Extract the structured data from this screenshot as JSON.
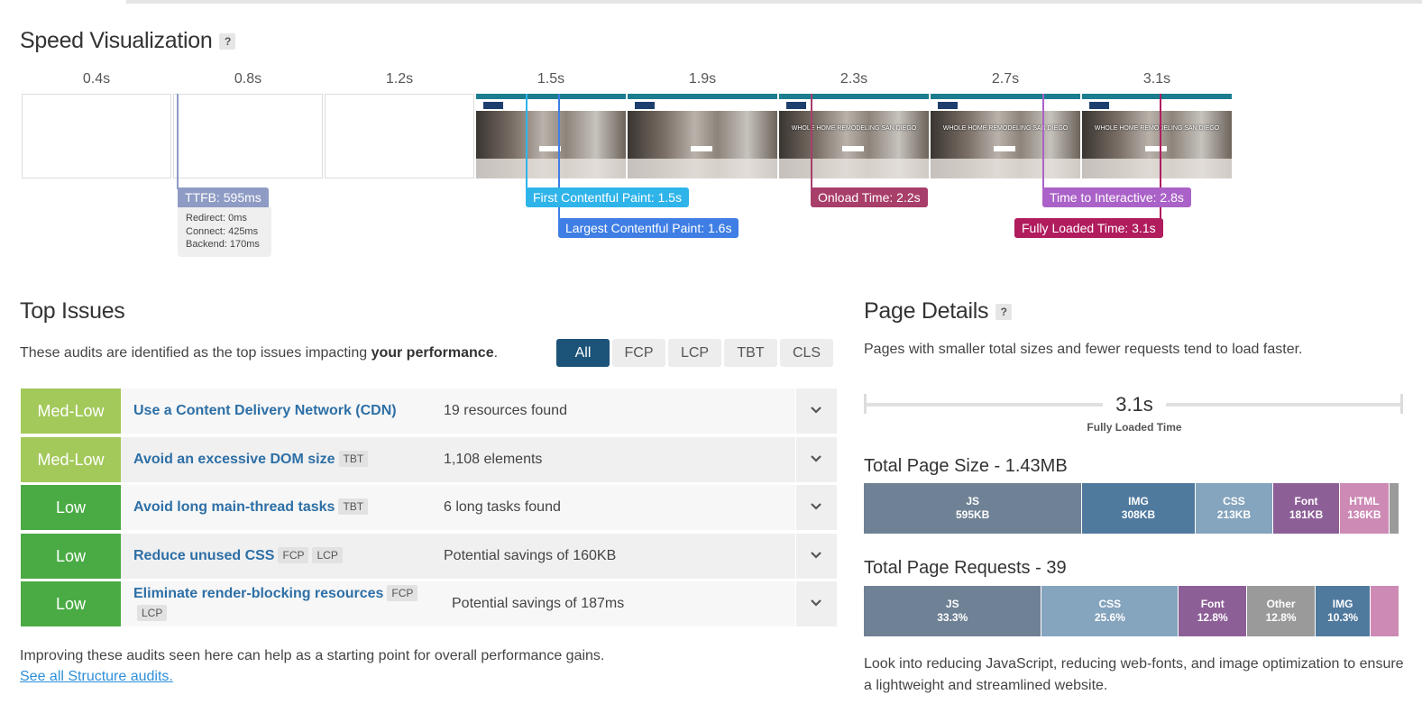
{
  "speed": {
    "title": "Speed Visualization",
    "help": "?",
    "frames": [
      {
        "time": "0.4s",
        "rendered": false
      },
      {
        "time": "0.8s",
        "rendered": false
      },
      {
        "time": "1.2s",
        "rendered": false
      },
      {
        "time": "1.5s",
        "rendered": true,
        "headline": ""
      },
      {
        "time": "1.9s",
        "rendered": true,
        "headline": ""
      },
      {
        "time": "2.3s",
        "rendered": true,
        "headline": "WHOLE HOME REMODELING SAN DIEGO"
      },
      {
        "time": "2.7s",
        "rendered": true,
        "headline": "WHOLE HOME REMODELING SAN DIEGO"
      },
      {
        "time": "3.1s",
        "rendered": true,
        "headline": "WHOLE HOME REMODELING SAN DIEGO"
      }
    ],
    "markers": {
      "ttfb": "TTFB: 595ms",
      "ttfb_details": [
        "Redirect: 0ms",
        "Connect: 425ms",
        "Backend: 170ms"
      ],
      "fcp": "First Contentful Paint: 1.5s",
      "lcp": "Largest Contentful Paint: 1.6s",
      "onload": "Onload Time: 2.2s",
      "tti": "Time to Interactive: 2.8s",
      "fully_loaded": "Fully Loaded Time: 3.1s"
    },
    "colors": {
      "ttfb": "#8e9bc4",
      "fcp": "#2fb4ea",
      "lcp": "#3f7ee4",
      "onload": "#a83e6a",
      "tti": "#ab62c8",
      "fully_loaded": "#b01c5e"
    }
  },
  "issues": {
    "title": "Top Issues",
    "intro_prefix": "These audits are identified as the top issues impacting ",
    "intro_bold": "your performance",
    "intro_suffix": ".",
    "filters": [
      "All",
      "FCP",
      "LCP",
      "TBT",
      "CLS"
    ],
    "active_filter": "All",
    "rows": [
      {
        "severity": "Med-Low",
        "name": "Use a Content Delivery Network (CDN)",
        "tags": [],
        "value": "19 resources found"
      },
      {
        "severity": "Med-Low",
        "name": "Avoid an excessive DOM size",
        "tags": [
          "TBT"
        ],
        "value": "1,108 elements"
      },
      {
        "severity": "Low",
        "name": "Avoid long main-thread tasks",
        "tags": [
          "TBT"
        ],
        "value": "6 long tasks found"
      },
      {
        "severity": "Low",
        "name": "Reduce unused CSS",
        "tags": [
          "FCP",
          "LCP"
        ],
        "value": "Potential savings of 160KB"
      },
      {
        "severity": "Low",
        "name": "Eliminate render-blocking resources",
        "tags": [
          "FCP",
          "LCP"
        ],
        "value": "Potential savings of 187ms"
      }
    ],
    "footer": "Improving these audits seen here can help as a starting point for overall performance gains.",
    "link": "See all Structure audits."
  },
  "details": {
    "title": "Page Details",
    "help": "?",
    "intro": "Pages with smaller total sizes and fewer requests tend to load faster.",
    "fully_loaded_value": "3.1s",
    "fully_loaded_label": "Fully Loaded Time",
    "size_title": "Total Page Size - 1.43MB",
    "size_segments": [
      {
        "name": "JS",
        "value": "595KB",
        "share": 0.416,
        "color": "#6f8195"
      },
      {
        "name": "IMG",
        "value": "308KB",
        "share": 0.215,
        "color": "#50799e"
      },
      {
        "name": "CSS",
        "value": "213KB",
        "share": 0.149,
        "color": "#85a4bd"
      },
      {
        "name": "Font",
        "value": "181KB",
        "share": 0.126,
        "color": "#8d5f97"
      },
      {
        "name": "HTML",
        "value": "136KB",
        "share": 0.095,
        "color": "#cd8ab5"
      },
      {
        "name": "",
        "value": "",
        "share": 0.017,
        "color": "#9a9a9a"
      }
    ],
    "requests_title": "Total Page Requests - 39",
    "request_segments": [
      {
        "name": "JS",
        "value": "33.3%",
        "share": 0.333,
        "color": "#6f8195"
      },
      {
        "name": "CSS",
        "value": "25.6%",
        "share": 0.256,
        "color": "#85a4bd"
      },
      {
        "name": "Font",
        "value": "12.8%",
        "share": 0.128,
        "color": "#8d5f97"
      },
      {
        "name": "Other",
        "value": "12.8%",
        "share": 0.128,
        "color": "#9a9a9a"
      },
      {
        "name": "IMG",
        "value": "10.3%",
        "share": 0.103,
        "color": "#50799e"
      },
      {
        "name": "",
        "value": "",
        "share": 0.052,
        "color": "#cd8ab5"
      }
    ],
    "footer": "Look into reducing JavaScript, reducing web-fonts, and image optimization to ensure a lightweight and streamlined website."
  }
}
